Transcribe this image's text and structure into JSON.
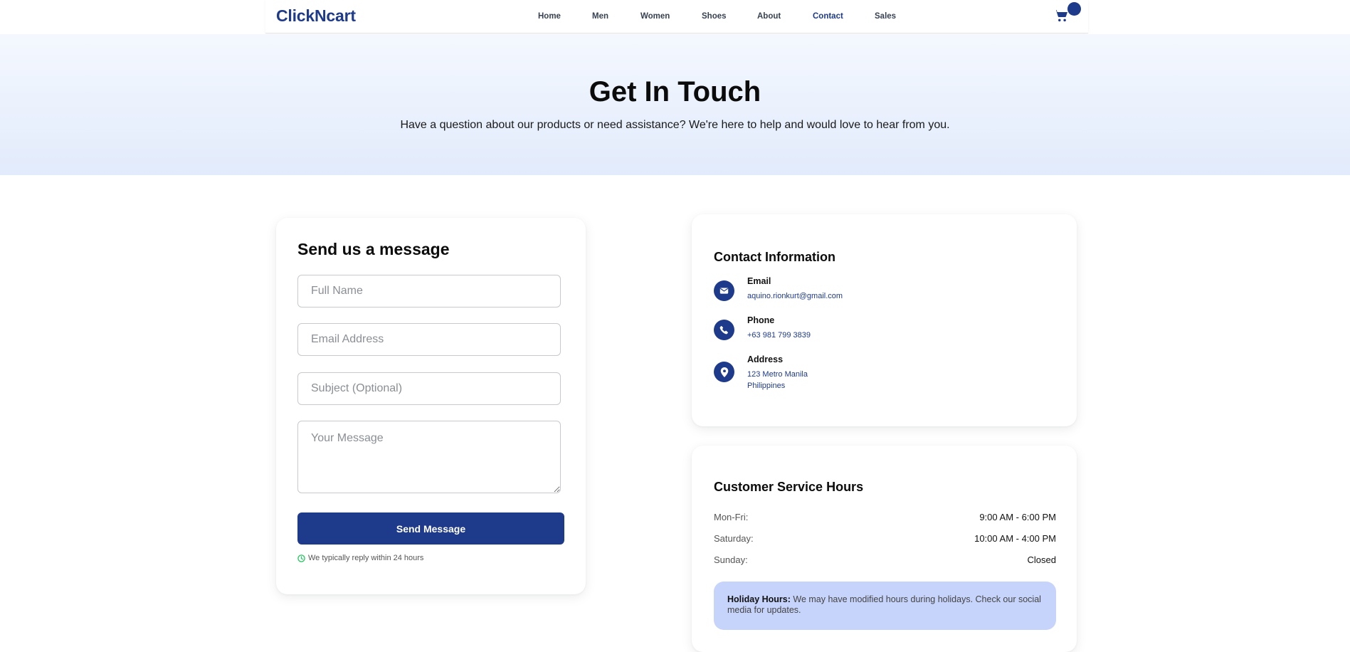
{
  "header": {
    "logo": "ClickNcart",
    "nav": [
      "Home",
      "Men",
      "Women",
      "Shoes",
      "About",
      "Contact",
      "Sales"
    ],
    "active_nav": "Contact",
    "cart_icon": "shopping-cart-icon"
  },
  "hero": {
    "title": "Get In Touch",
    "subtitle": "Have a question about our products or need assistance? We're here to help and would love to hear from you."
  },
  "form": {
    "title": "Send us a message",
    "fields": {
      "full_name": "Full Name",
      "email": "Email Address",
      "subject": "Subject (Optional)",
      "message": "Your Message"
    },
    "submit_label": "Send Message",
    "reply_note": "We typically reply within 24 hours"
  },
  "contact": {
    "title": "Contact Information",
    "items": [
      {
        "label": "Email",
        "value": "aquino.rionkurt@gmail.com",
        "icon": "envelope-icon"
      },
      {
        "label": "Phone",
        "value": "+63 981 799 3839",
        "icon": "phone-icon"
      },
      {
        "label": "Address",
        "value_line1": "123 Metro Manila",
        "value_line2": "Philippines",
        "icon": "map-pin-icon"
      }
    ]
  },
  "hours": {
    "title": "Customer Service Hours",
    "rows": [
      {
        "day": "Mon-Fri:",
        "time": "9:00 AM - 6:00 PM"
      },
      {
        "day": "Saturday:",
        "time": "10:00 AM - 4:00 PM"
      },
      {
        "day": "Sunday:",
        "time": "Closed"
      }
    ],
    "holiday_label": "Holiday Hours:",
    "holiday_text": " We may have modified hours during holidays. Check our social media for updates."
  },
  "colors": {
    "brand": "#1e3a8a",
    "holiday_bg": "#c6d4fb",
    "reply_icon": "#22c55e"
  }
}
